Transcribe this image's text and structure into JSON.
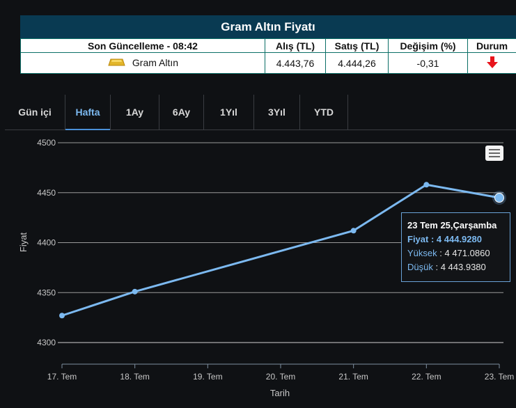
{
  "widget": {
    "title": "Gram Altın Fiyatı",
    "headers": {
      "updated": "Son Güncelleme - 08:42",
      "buy": "Alış (TL)",
      "sell": "Satış (TL)",
      "change": "Değişim (%)",
      "status": "Durum"
    },
    "row": {
      "name": "Gram Altın",
      "buy": "4.443,76",
      "sell": "4.444,26",
      "change": "-0,31",
      "status_icon": "down-arrow-icon",
      "status_color": "#e8141c"
    }
  },
  "tabs": [
    {
      "label": "Gün içi",
      "active": false
    },
    {
      "label": "Hafta",
      "active": true
    },
    {
      "label": "1Ay",
      "active": false
    },
    {
      "label": "6Ay",
      "active": false
    },
    {
      "label": "1Yıl",
      "active": false
    },
    {
      "label": "3Yıl",
      "active": false
    },
    {
      "label": "YTD",
      "active": false
    }
  ],
  "menu": {
    "icon": "hamburger-menu-icon"
  },
  "tooltip": {
    "date": "23 Tem 25,Çarşamba",
    "price_label": "Fiyat",
    "price_value": "4 444.9280",
    "high_label": "Yüksek",
    "high_value": "4 471.0860",
    "low_label": "Düşük",
    "low_value": "4 443.9380"
  },
  "chart_data": {
    "type": "line",
    "xlabel": "Tarih",
    "ylabel": "Fiyat",
    "categories": [
      "17. Tem",
      "18. Tem",
      "19. Tem",
      "20. Tem",
      "21. Tem",
      "22. Tem",
      "23. Tem"
    ],
    "series": [
      {
        "x": [
          "17. Tem",
          "18. Tem",
          "21. Tem",
          "22. Tem",
          "23. Tem"
        ],
        "values": [
          4327,
          4351,
          4412,
          4458,
          4444.928
        ],
        "color": "#7cb9f0"
      }
    ],
    "yticks": [
      4300,
      4350,
      4400,
      4450,
      4500
    ],
    "ylim": [
      4295,
      4500
    ],
    "grid": true,
    "highlight": "23. Tem"
  }
}
